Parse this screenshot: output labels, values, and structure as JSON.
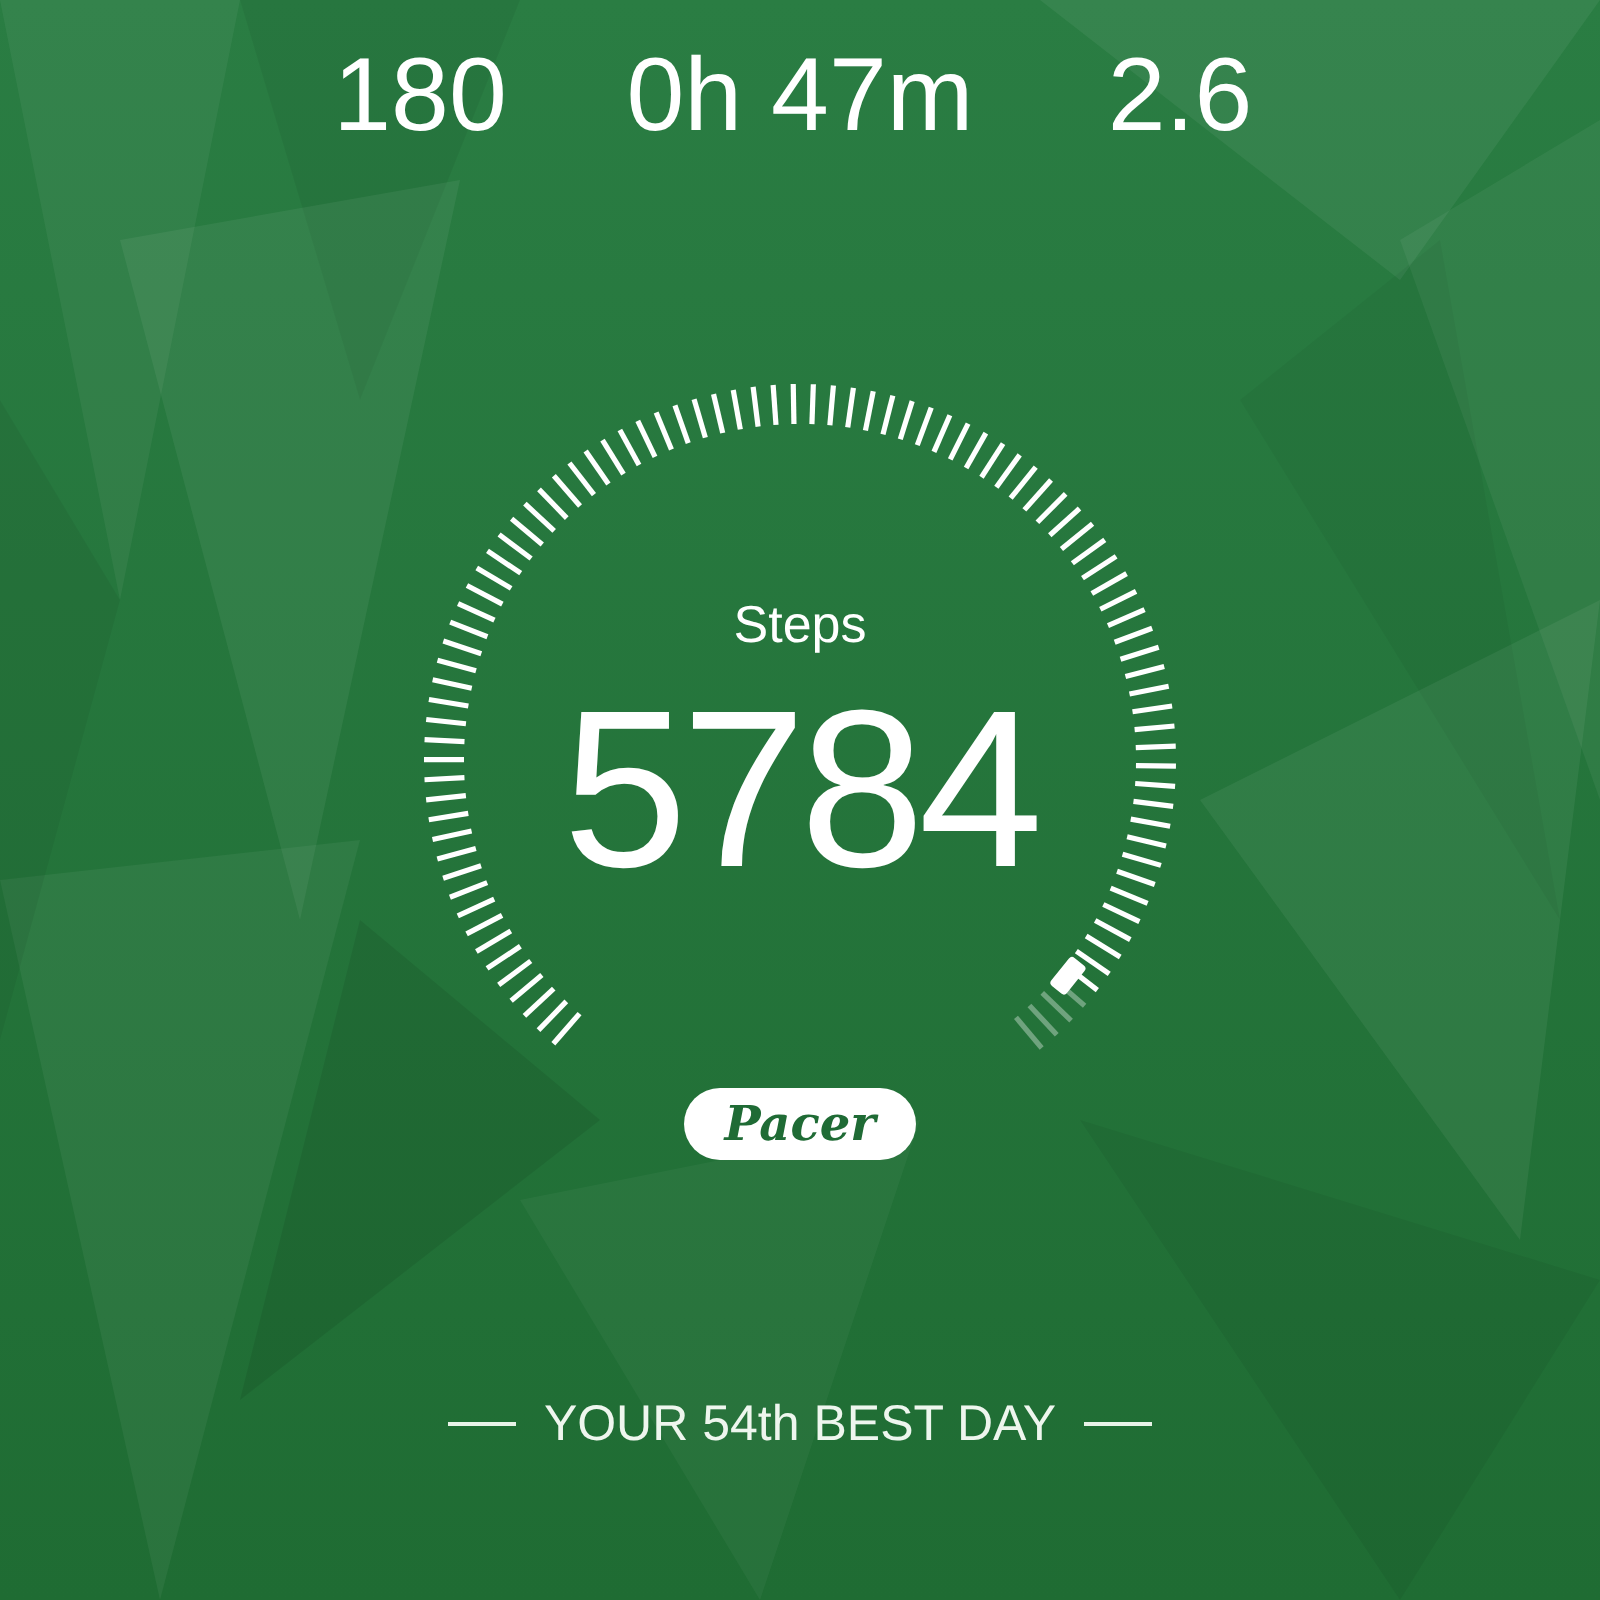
{
  "stats": [
    {
      "value": "180"
    },
    {
      "value": "0h 47m"
    },
    {
      "value": "2.6"
    }
  ],
  "gauge": {
    "label": "Steps",
    "value": "5784"
  },
  "logo": "Pacer",
  "footer": "YOUR 54th BEST DAY"
}
